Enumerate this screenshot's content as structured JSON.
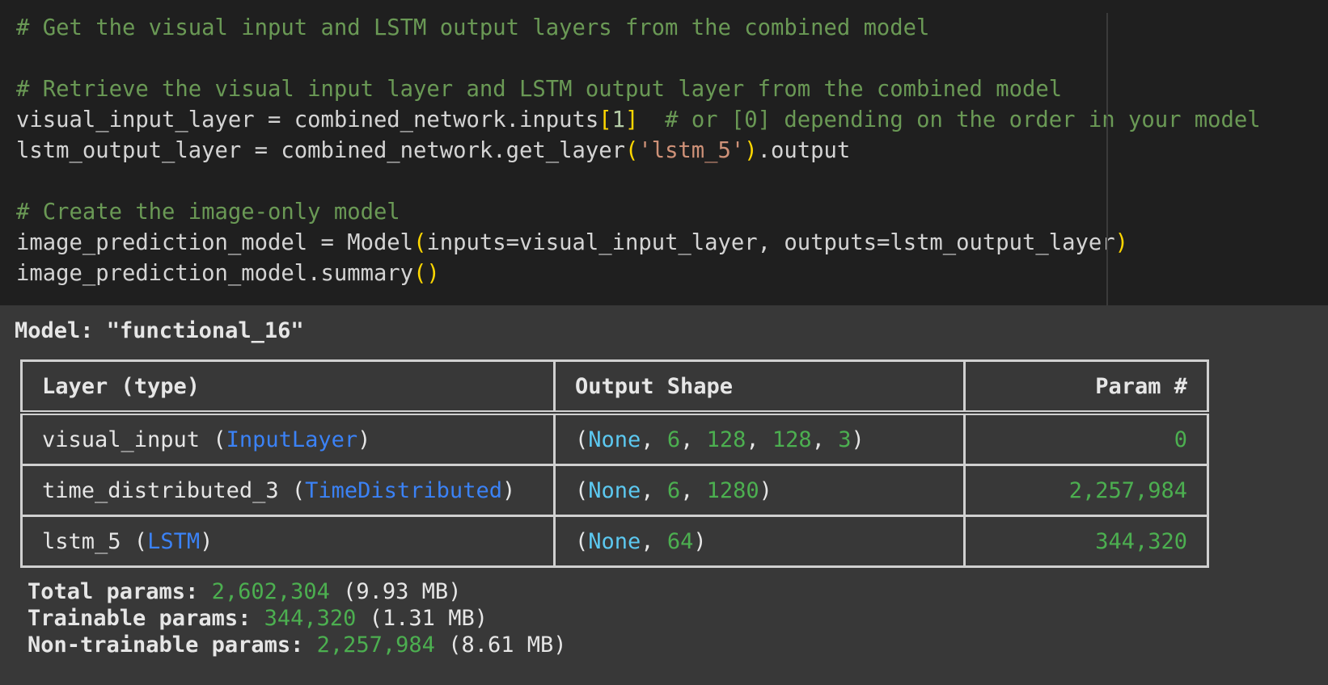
{
  "code_cell": {
    "line1": {
      "comment": "# Get the visual input and LSTM output layers from the combined model"
    },
    "line3": {
      "comment": "# Retrieve the visual input layer and LSTM output layer from the combined model"
    },
    "line4": {
      "code": "visual_input_layer = combined_network.inputs",
      "open": "[",
      "index": "1",
      "close": "]",
      "comment": "  # or [0] depending on the order in your model"
    },
    "line5": {
      "code": "lstm_output_layer = combined_network.get_layer",
      "open": "(",
      "arg": "'lstm_5'",
      "close": ")",
      "tail": ".output"
    },
    "line7": {
      "comment": "# Create the image-only model"
    },
    "line8": {
      "code": "image_prediction_model = Model",
      "open": "(",
      "args": "inputs=visual_input_layer, outputs=lstm_output_layer",
      "close": ")"
    },
    "line9": {
      "code": "image_prediction_model.summary",
      "parens": "()"
    }
  },
  "output": {
    "model_label": "Model: \"functional_16\"",
    "table": {
      "headers": [
        "Layer (type)",
        "Output Shape",
        "Param #"
      ],
      "rows": [
        {
          "name": "visual_input",
          "open": " (",
          "type": "InputLayer",
          "close": ")",
          "shape": {
            "open": "(",
            "none": "None",
            "sep1": ", ",
            "d1": "6",
            "sep2": ", ",
            "d2": "128",
            "sep3": ", ",
            "d3": "128",
            "sep4": ", ",
            "d4": "3",
            "close": ")"
          },
          "params": "0"
        },
        {
          "name": "time_distributed_3",
          "open": " (",
          "type": "TimeDistributed",
          "close": ")",
          "shape": {
            "open": "(",
            "none": "None",
            "sep1": ", ",
            "d1": "6",
            "sep2": ", ",
            "d2": "1280",
            "close": ")"
          },
          "params": "2,257,984"
        },
        {
          "name": "lstm_5",
          "open": " (",
          "type": "LSTM",
          "close": ")",
          "shape": {
            "open": "(",
            "none": "None",
            "sep1": ", ",
            "d1": "64",
            "close": ")"
          },
          "params": "344,320"
        }
      ]
    },
    "totals": {
      "total": {
        "label": "Total params: ",
        "value": "2,602,304",
        "size": " (9.93 MB)"
      },
      "trainable": {
        "label": "Trainable params: ",
        "value": "344,320",
        "size": " (1.31 MB)"
      },
      "non_trainable": {
        "label": "Non-trainable params: ",
        "value": "2,257,984",
        "size": " (8.61 MB)"
      }
    }
  },
  "colors": {
    "code_bg": "#1f1f1f",
    "output_bg": "#383838",
    "comment": "#6a9955",
    "string": "#ce9178",
    "bracket": "#ffd700",
    "class_name": "#3b82f6",
    "none_value": "#5cc8f0",
    "number": "#4caf50"
  }
}
